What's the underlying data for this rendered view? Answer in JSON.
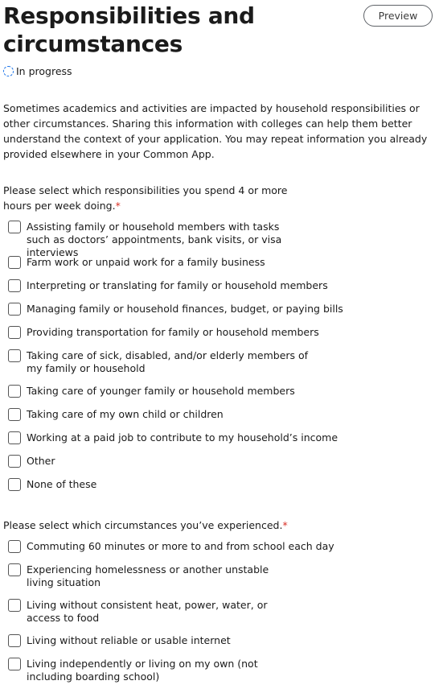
{
  "header": {
    "title": "Responsibilities and circumstances",
    "preview_label": "Preview",
    "status": "In progress"
  },
  "intro": "Sometimes academics and activities are impacted by household responsibilities or other circumstances. Sharing this information with colleges can help them better understand the context of your application. You may repeat information you already provided elsewhere in your Common App.",
  "responsibilities": {
    "question": "Please select which responsibilities you spend 4 or more hours per week doing.",
    "required_mark": "*",
    "options": [
      {
        "label": "Assisting family or household members with tasks such as doctors’ appointments, bank visits, or visa interviews",
        "checked": false
      },
      {
        "label": "Farm work or unpaid work for a family business",
        "checked": false
      },
      {
        "label": "Interpreting or translating for family or household members",
        "checked": false
      },
      {
        "label": "Managing family or household finances, budget, or paying bills",
        "checked": false
      },
      {
        "label": "Providing transportation for family or household members",
        "checked": false
      },
      {
        "label": "Taking care of sick, disabled, and/or elderly members of my family or household",
        "checked": false
      },
      {
        "label": "Taking care of younger family or household members",
        "checked": false
      },
      {
        "label": "Taking care of my own child or children",
        "checked": false
      },
      {
        "label": "Working at a paid job to contribute to my household’s income",
        "checked": false
      },
      {
        "label": "Other",
        "checked": false
      },
      {
        "label": "None of these",
        "checked": false
      }
    ]
  },
  "circumstances": {
    "question": "Please select which circumstances you’ve experienced.",
    "required_mark": "*",
    "options": [
      {
        "label": "Commuting 60 minutes or more to and from school each day",
        "checked": false
      },
      {
        "label": "Experiencing homelessness or another unstable living situation",
        "checked": false
      },
      {
        "label": "Living without consistent heat, power, water, or access to food",
        "checked": false
      },
      {
        "label": "Living without reliable or usable internet",
        "checked": false
      },
      {
        "label": "Living independently or living on my own (not including boarding school)",
        "checked": false
      }
    ]
  },
  "colors": {
    "status_icon": "#1a73e8",
    "required": "#d93025"
  },
  "icons": {
    "status": "dashed-circle-in-progress-icon",
    "checkbox": "unchecked-checkbox-icon"
  }
}
